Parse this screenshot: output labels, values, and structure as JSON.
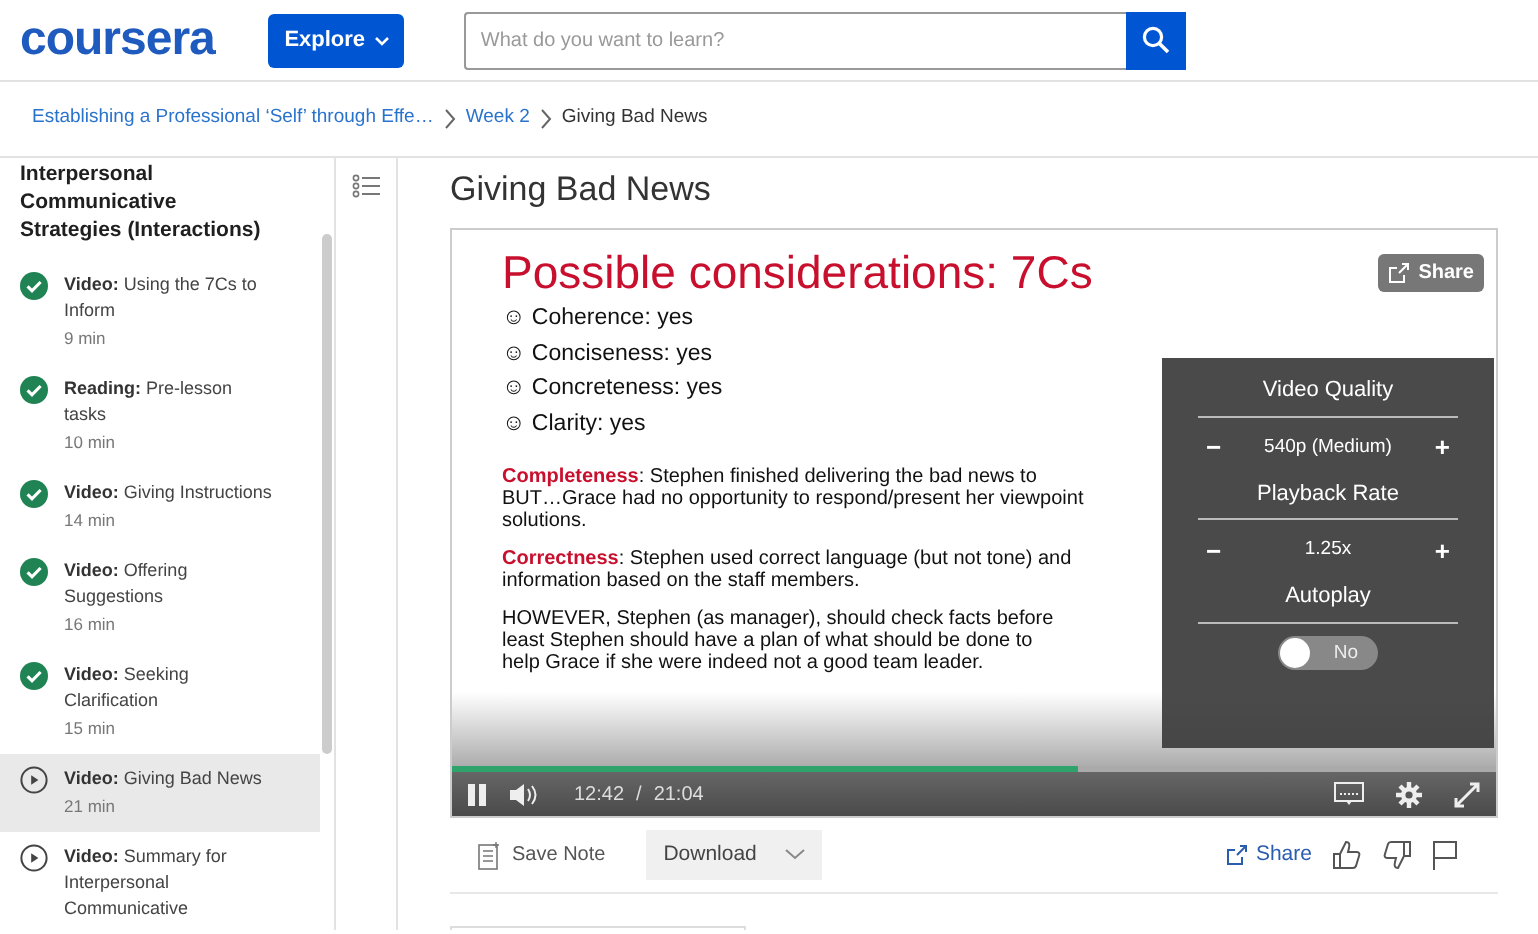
{
  "header": {
    "logo": "coursera",
    "explore_button": "Explore",
    "search": {
      "placeholder": "What do you want to learn?"
    }
  },
  "breadcrumb": [
    "Establishing a Professional ‘Self’ through Effe…",
    "Week 2",
    "Giving Bad News"
  ],
  "sidebar": {
    "heading": "Interpersonal Communicative Strategies (Interactions)",
    "items": [
      {
        "type": "Video:",
        "title": "Using the 7Cs to Inform",
        "duration": "9 min",
        "completed": true,
        "selected": false
      },
      {
        "type": "Reading:",
        "title": "Pre-lesson tasks",
        "duration": "10 min",
        "completed": true,
        "selected": false
      },
      {
        "type": "Video:",
        "title": "Giving Instructions",
        "duration": "14 min",
        "completed": true,
        "selected": false
      },
      {
        "type": "Video:",
        "title": "Offering Suggestions",
        "duration": "16 min",
        "completed": true,
        "selected": false
      },
      {
        "type": "Video:",
        "title": "Seeking Clarification",
        "duration": "15 min",
        "completed": true,
        "selected": false
      },
      {
        "type": "Video:",
        "title": "Giving Bad News",
        "duration": "21 min",
        "completed": false,
        "selected": true
      },
      {
        "type": "Video:",
        "title": "Summary for Interpersonal Communicative",
        "completed": false,
        "selected": false
      }
    ]
  },
  "page_title": "Giving Bad News",
  "video": {
    "slide": {
      "title": "Possible considerations: 7Cs",
      "checks": [
        "☺ Coherence:  yes",
        "☺ Conciseness:  yes",
        "☺ Concreteness:  yes",
        "☺ Clarity:  yes"
      ],
      "paragraphs": [
        [
          "**Completeness**: Stephen finished delivering the bad news to",
          "BUT…Grace had no opportunity to respond/present her viewpoint",
          "solutions."
        ],
        [
          "**Correctness**: Stephen used correct language (but not tone) and",
          "information based on the staff members."
        ],
        [
          "HOWEVER, Stephen (as manager), should check facts before",
          "least Stephen should have a plan of what should be done to",
          "help Grace if she were indeed not a good team leader."
        ]
      ]
    },
    "share_button": "Share",
    "settings": [
      {
        "kind": "stepper",
        "label": "Video Quality",
        "value": "540p (Medium)",
        "minus": "−",
        "plus": "+"
      },
      {
        "kind": "stepper",
        "label": "Playback Rate",
        "value": "1.25x",
        "minus": "−",
        "plus": "+"
      },
      {
        "kind": "toggle",
        "label": "Autoplay",
        "value": "No",
        "on": false
      }
    ],
    "level": 0.6,
    "playing": true,
    "time": "12:42",
    "separator": "/",
    "duration": "21:04"
  },
  "toolbar": {
    "save_note": "Save Note",
    "download": "Download",
    "share": "Share"
  }
}
